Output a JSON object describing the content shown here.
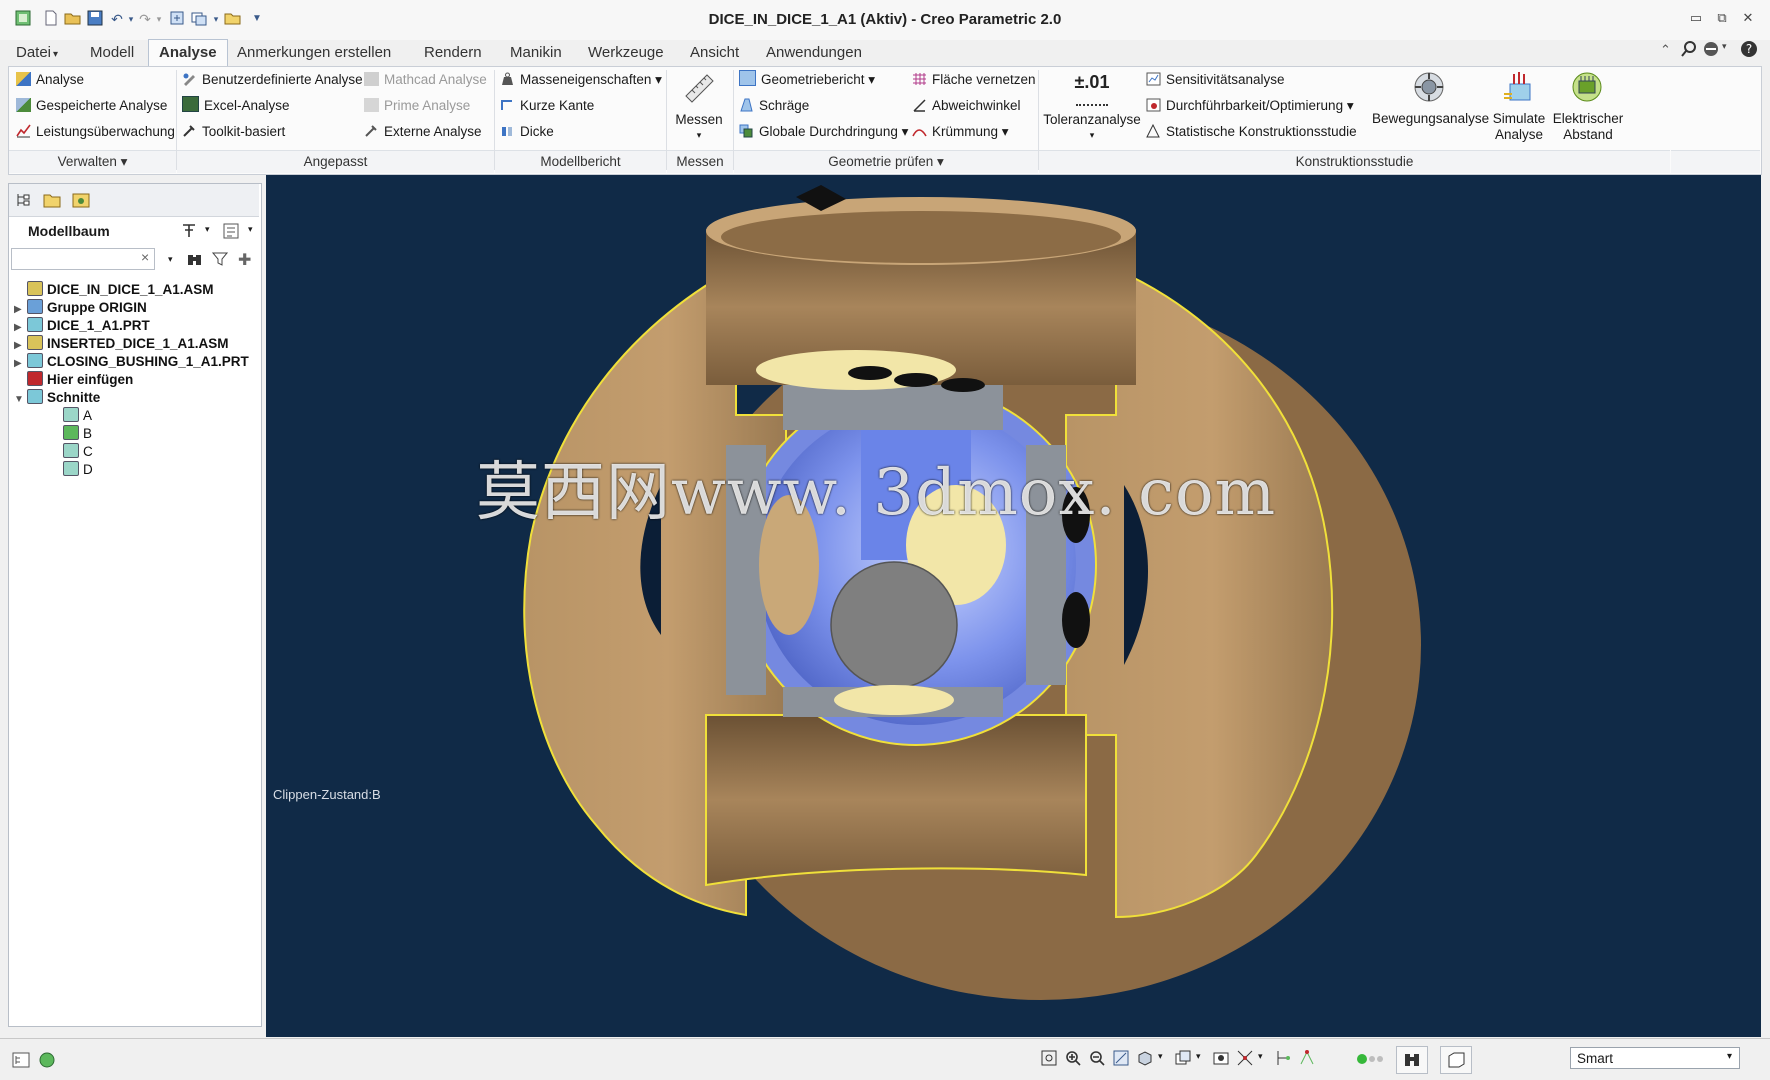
{
  "window": {
    "title": "DICE_IN_DICE_1_A1 (Aktiv) - Creo Parametric 2.0",
    "controls": {
      "minimize": "▭",
      "maximize": "⧉",
      "close": "✕"
    }
  },
  "quick_access": [
    "new-icon",
    "open-icon",
    "save-icon",
    "undo-icon",
    "redo-icon",
    "regenerate-icon",
    "windows-icon",
    "folder-icon",
    "customize-icon"
  ],
  "menu_tabs": [
    {
      "label": "Datei",
      "dropdown": "▾"
    },
    {
      "label": "Modell"
    },
    {
      "label": "Analyse",
      "active": true
    },
    {
      "label": "Anmerkungen erstellen"
    },
    {
      "label": "Rendern"
    },
    {
      "label": "Manikin"
    },
    {
      "label": "Werkzeuge"
    },
    {
      "label": "Ansicht"
    },
    {
      "label": "Anwendungen"
    }
  ],
  "ribbon": {
    "verwalten": {
      "items": [
        "Analyse",
        "Gespeicherte Analyse",
        "Leistungsüberwachung"
      ],
      "group": "Verwalten ▾"
    },
    "angepasst": {
      "col1": [
        "Benutzerdefinierte Analyse",
        "Excel-Analyse",
        "Toolkit-basiert"
      ],
      "col2": [
        "Mathcad Analyse",
        "Prime Analyse",
        "Externe Analyse"
      ],
      "group": "Angepasst"
    },
    "modellbericht": {
      "items": [
        "Masseneigenschaften ▾",
        "Kurze Kante",
        "Dicke"
      ],
      "group": "Modellbericht"
    },
    "messen": {
      "button": "Messen",
      "arrow": "▾",
      "group": "Messen"
    },
    "geometrie": {
      "col1": [
        "Geometriebericht ▾",
        "Schräge",
        "Globale Durchdringung ▾"
      ],
      "col2": [
        "Fläche vernetzen",
        "Abweichwinkel",
        "Krümmung ▾"
      ],
      "group": "Geometrie prüfen ▾"
    },
    "konstruktion": {
      "tolerance_badge": "±.01",
      "tolerance_label": "Toleranzanalyse",
      "tolerance_arrow": "▾",
      "items": [
        "Sensitivitätsanalyse",
        "Durchführbarkeit/Optimierung ▾",
        "Statistische Konstruktionsstudie"
      ],
      "bewegung": "Bewegungsanalyse",
      "simulate": [
        "Simulate",
        "Analyse"
      ],
      "elektrisch": [
        "Elektrischer",
        "Abstand"
      ],
      "group": "Konstruktionsstudie"
    }
  },
  "panel": {
    "title": "Modellbaum",
    "search_clear": "×",
    "tree": [
      {
        "label": "DICE_IN_DICE_1_A1.ASM",
        "toggle": "",
        "color": "#d9c35a"
      },
      {
        "label": "Gruppe ORIGIN",
        "toggle": "▶",
        "color": "#6aa0d8"
      },
      {
        "label": "DICE_1_A1.PRT",
        "toggle": "▶",
        "color": "#7cc8d8"
      },
      {
        "label": "INSERTED_DICE_1_A1.ASM",
        "toggle": "▶",
        "color": "#d9c35a"
      },
      {
        "label": "CLOSING_BUSHING_1_A1.PRT",
        "toggle": "▶",
        "color": "#7cc8d8"
      },
      {
        "label": "Hier einfügen",
        "toggle": "",
        "color": "#c0282d"
      },
      {
        "label": "Schnitte",
        "toggle": "▼",
        "color": "#7cc8d8"
      },
      {
        "label": "A",
        "toggle": "",
        "color": "#9bd6c8"
      },
      {
        "label": "B",
        "toggle": "",
        "color": "#5cb85c"
      },
      {
        "label": "C",
        "toggle": "",
        "color": "#9bd6c8"
      },
      {
        "label": "D",
        "toggle": "",
        "color": "#9bd6c8"
      }
    ]
  },
  "viewport": {
    "watermark": "莫西网www. 3dmox. com",
    "clip_status": "Clippen-Zustand:B",
    "background": "#102a47"
  },
  "statusbar": {
    "filter_value": "Smart",
    "filter_arrow": "▾"
  }
}
